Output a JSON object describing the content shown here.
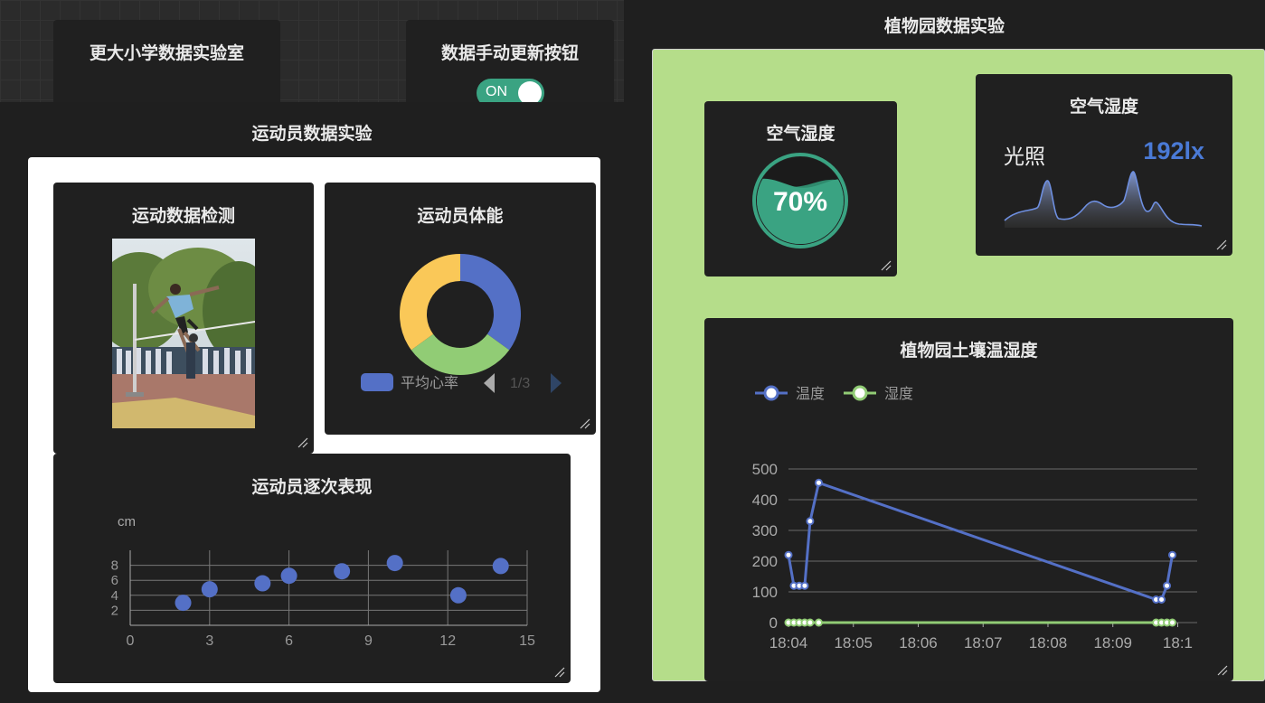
{
  "header": {
    "school_lab_title": "更大小学数据实验室",
    "manual_update_title": "数据手动更新按钮",
    "toggle_label": "ON"
  },
  "athlete_panel": {
    "title": "运动员数据实验",
    "detection_card": {
      "title": "运动数据检测"
    },
    "fitness_card": {
      "title": "运动员体能",
      "legend_label": "平均心率",
      "pagination": "1/3",
      "donut_colors": [
        "#5470c6",
        "#91cc75",
        "#fac858"
      ],
      "donut_values": [
        35,
        30,
        35
      ]
    },
    "performance_card": {
      "title": "运动员逐次表现",
      "y_unit": "cm"
    }
  },
  "garden_panel": {
    "title": "植物园数据实验",
    "humidity_gauge_card": {
      "title": "空气湿度",
      "value": "70%",
      "level": 0.7,
      "color": "#3aa382"
    },
    "light_card": {
      "title": "空气湿度",
      "label": "光照",
      "value": "192lx",
      "value_color": "#4a7ad6"
    },
    "soil_card": {
      "title": "植物园土壤温湿度",
      "legend": [
        "温度",
        "湿度"
      ]
    }
  },
  "chart_data": [
    {
      "type": "pie",
      "title": "运动员体能",
      "categories": [
        "平均心率",
        "",
        ""
      ],
      "values": [
        35,
        30,
        35
      ]
    },
    {
      "type": "scatter",
      "title": "运动员逐次表现",
      "ylabel": "cm",
      "x": [
        2,
        3,
        5,
        6,
        8,
        10,
        12.4,
        14
      ],
      "y": [
        3,
        4.8,
        5.6,
        6.6,
        7.2,
        8.3,
        4,
        7.9
      ],
      "xlim": [
        0,
        15
      ],
      "ylim": [
        0,
        10
      ],
      "xticks": [
        "0",
        "3",
        "6",
        "9",
        "12",
        "15"
      ],
      "yticks": [
        "2",
        "4",
        "6",
        "8"
      ]
    },
    {
      "type": "line",
      "title": "植物园土壤温湿度",
      "x": [
        "18:04:00",
        "18:04:05",
        "18:04:10",
        "18:04:15",
        "18:04:20",
        "18:04:28",
        "18:09:40",
        "18:09:45",
        "18:09:50",
        "18:09:55"
      ],
      "series": [
        {
          "name": "温度",
          "color": "#5470c6",
          "values": [
            220,
            120,
            120,
            120,
            330,
            455,
            75,
            75,
            120,
            220
          ]
        },
        {
          "name": "湿度",
          "color": "#91cc75",
          "values": [
            0,
            0,
            0,
            0,
            0,
            0,
            0,
            0,
            0,
            0
          ]
        }
      ],
      "ylim": [
        0,
        500
      ],
      "yticks": [
        "0",
        "100",
        "200",
        "300",
        "400",
        "500"
      ],
      "xticks": [
        "18:04",
        "18:05",
        "18:06",
        "18:07",
        "18:08",
        "18:09",
        "18:1"
      ],
      "grid": true
    }
  ]
}
